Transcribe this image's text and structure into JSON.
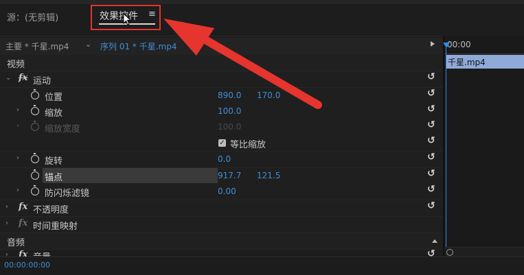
{
  "tabs": {
    "source": "源：(无剪辑)",
    "effect_controls": "效果控件",
    "menu_icon": "≡"
  },
  "source_row": {
    "master": "主要 * 千星.mp4",
    "chevron": "⌄",
    "sequence": "序列 01 * 千星.mp4"
  },
  "sections": {
    "video": "视频",
    "audio": "音频"
  },
  "effects": {
    "motion": "运动",
    "opacity": "不透明度",
    "time_remap": "时间重映射",
    "volume": "音量"
  },
  "properties": {
    "position": {
      "label": "位置",
      "x": "890.0",
      "y": "170.0"
    },
    "scale": {
      "label": "缩放",
      "value": "100.0"
    },
    "scale_width": {
      "label": "缩放宽度",
      "value": "100.0"
    },
    "uniform_scale": {
      "label": "等比缩放",
      "checked": true
    },
    "rotation": {
      "label": "旋转",
      "value": "0.0"
    },
    "anchor": {
      "label": "锚点",
      "x": "917.7",
      "y": "121.5"
    },
    "anti_flicker": {
      "label": "防闪烁滤镜",
      "value": "0.00"
    }
  },
  "timeline": {
    "timecode": "00:00",
    "clip_label": "千星.mp4"
  },
  "status": {
    "timecode": "00:00:00:00"
  },
  "colors": {
    "accent_blue": "#3f8fd6",
    "annotation_red": "#e5352e",
    "clip": "#8fa9d8"
  },
  "icons": {
    "reset": "↺",
    "fx": "fx"
  }
}
